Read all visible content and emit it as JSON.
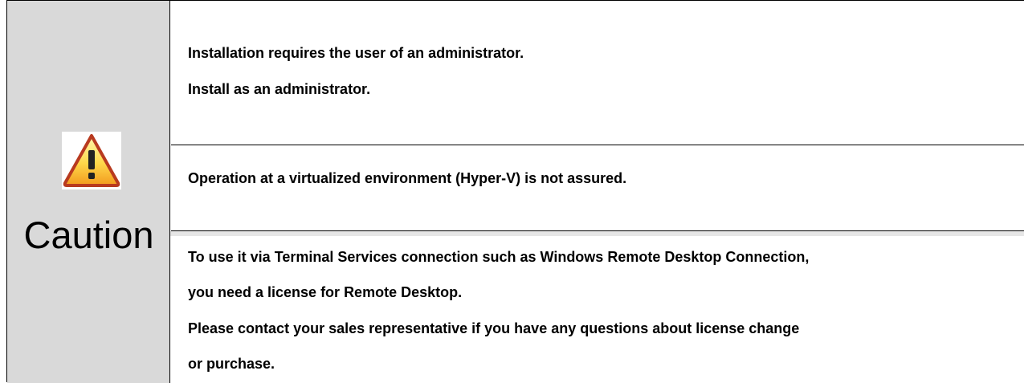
{
  "caution": {
    "label": "Caution",
    "icon": "warning-triangle-icon",
    "icon_colors": {
      "fill_top": "#fff3a0",
      "fill_bottom": "#f5a623",
      "outline": "#c0392b"
    }
  },
  "rows": [
    {
      "lines": [
        "Installation requires the user of an administrator.",
        "Install as an administrator."
      ]
    },
    {
      "lines": [
        "Operation at a virtualized environment (Hyper-V) is not assured."
      ]
    },
    {
      "lines": [
        "To use it via Terminal Services connection such as Windows Remote Desktop Connection,",
        "you need a license for Remote Desktop.",
        "Please contact your sales representative if you have any questions about license change",
        "or purchase."
      ]
    }
  ]
}
